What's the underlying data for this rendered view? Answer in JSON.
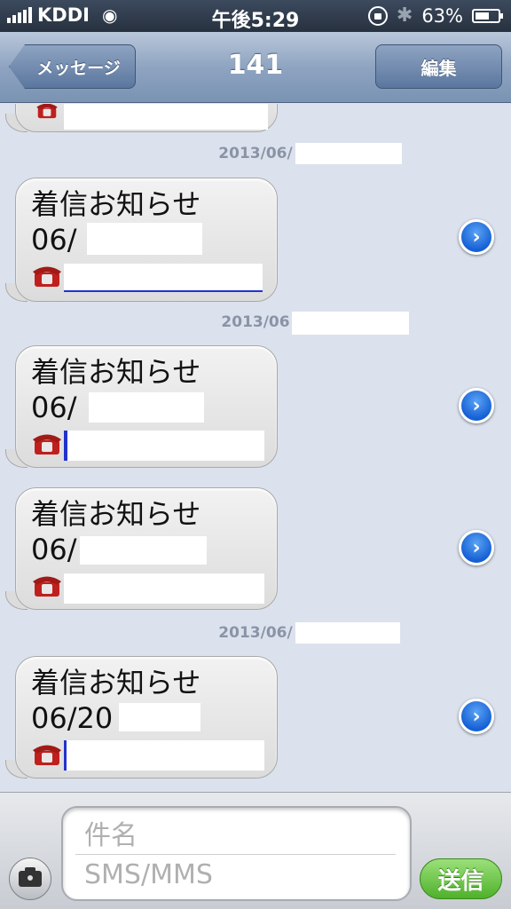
{
  "status_bar": {
    "carrier": "KDDI",
    "time": "午後5:29",
    "battery": "63%",
    "battery_level": 0.63
  },
  "nav": {
    "back_label": "メッセージ",
    "title": "141",
    "edit_label": "編集"
  },
  "messages": [
    {
      "type": "partial_bubble"
    },
    {
      "type": "timestamp",
      "text": "2013/06/"
    },
    {
      "type": "bubble",
      "title": "着信お知らせ",
      "date": "06/"
    },
    {
      "type": "timestamp",
      "text": "2013/06"
    },
    {
      "type": "bubble",
      "title": "着信お知らせ",
      "date": "06/"
    },
    {
      "type": "bubble",
      "title": "着信お知らせ",
      "date": "06/"
    },
    {
      "type": "timestamp",
      "text": "2013/06/"
    },
    {
      "type": "bubble",
      "title": "着信お知らせ",
      "date": "06/20"
    }
  ],
  "input_bar": {
    "subject_placeholder": "件名",
    "body_placeholder": "SMS/MMS",
    "send_label": "送信"
  },
  "icons": {
    "phone": "telephone-icon",
    "detail": "detail-disclosure-icon",
    "camera": "camera-icon"
  },
  "colors": {
    "send_green": "#4fb12b",
    "disclosure_blue": "#1660d5",
    "nav_blue": "#8ea4c1"
  }
}
